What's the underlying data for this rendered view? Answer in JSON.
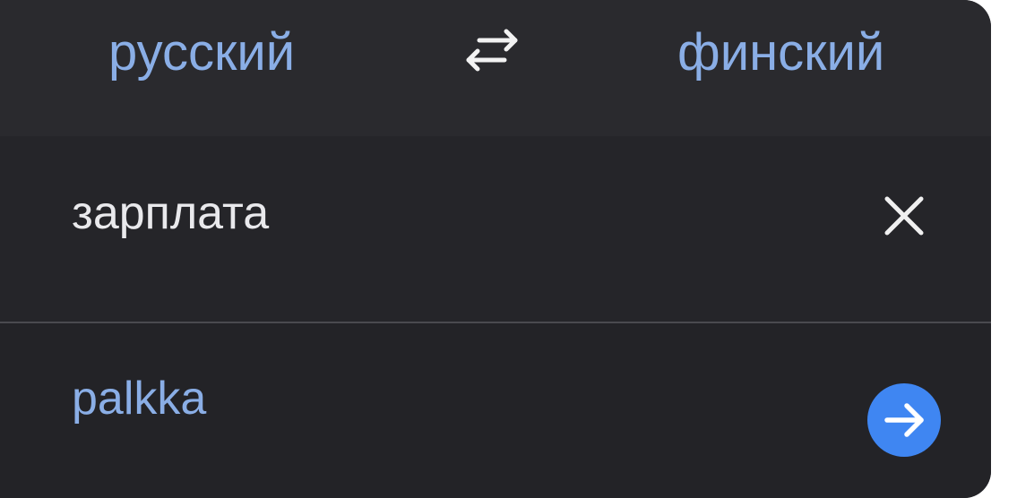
{
  "languages": {
    "source": "русский",
    "target": "финский"
  },
  "input": {
    "value": "зарплата"
  },
  "output": {
    "translation": "palkka"
  },
  "icons": {
    "swap": "swap-arrows-icon",
    "clear": "close-icon",
    "go": "arrow-right-icon"
  },
  "colors": {
    "accent_text": "#8aaee6",
    "button_blue": "#3f86f2",
    "background": "#232327"
  }
}
